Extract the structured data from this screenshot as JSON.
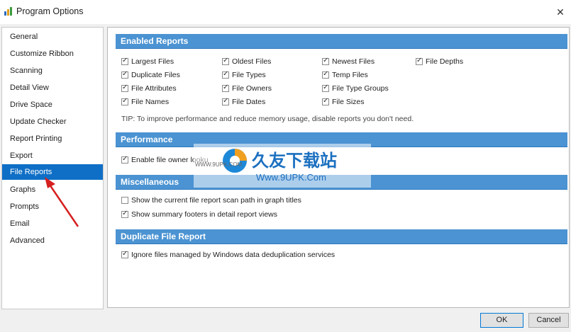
{
  "window": {
    "title": "Program Options",
    "close_glyph": "✕"
  },
  "sidebar": {
    "items": [
      {
        "label": "General"
      },
      {
        "label": "Customize Ribbon"
      },
      {
        "label": "Scanning"
      },
      {
        "label": "Detail View"
      },
      {
        "label": "Drive Space"
      },
      {
        "label": "Update Checker"
      },
      {
        "label": "Report Printing"
      },
      {
        "label": "Export"
      },
      {
        "label": "File Reports",
        "selected": true
      },
      {
        "label": "Graphs"
      },
      {
        "label": "Prompts"
      },
      {
        "label": "Email"
      },
      {
        "label": "Advanced"
      }
    ]
  },
  "sections": {
    "enabled_reports": {
      "title": "Enabled Reports",
      "options": [
        {
          "label": "Largest Files",
          "checked": true
        },
        {
          "label": "Oldest Files",
          "checked": true
        },
        {
          "label": "Newest Files",
          "checked": true
        },
        {
          "label": "File Depths",
          "checked": true
        },
        {
          "label": "Duplicate Files",
          "checked": true
        },
        {
          "label": "File Types",
          "checked": true
        },
        {
          "label": "Temp Files",
          "checked": true
        },
        {
          "label": "File Attributes",
          "checked": true
        },
        {
          "label": "File Owners",
          "checked": true
        },
        {
          "label": "File Type Groups",
          "checked": true
        },
        {
          "label": "File Names",
          "checked": true
        },
        {
          "label": "File Dates",
          "checked": true
        },
        {
          "label": "File Sizes",
          "checked": true
        }
      ],
      "tip": "TIP: To improve performance and reduce memory usage, disable reports you don't need."
    },
    "performance": {
      "title": "Performance",
      "options": [
        {
          "label": "Enable file owner looku",
          "checked": true
        }
      ]
    },
    "miscellaneous": {
      "title": "Miscellaneous",
      "options": [
        {
          "label": "Show the current file report scan path in graph titles",
          "checked": false
        },
        {
          "label": "Show summary footers in detail report views",
          "checked": true
        }
      ]
    },
    "duplicate_file_report": {
      "title": "Duplicate File Report",
      "options": [
        {
          "label": "Ignore files managed by Windows data deduplication services",
          "checked": true
        }
      ]
    }
  },
  "buttons": {
    "ok": "OK",
    "cancel": "Cancel"
  },
  "watermark": {
    "text": "久友下载站",
    "url": "Www.9UPK.Com",
    "small": "WWW.9UPK.COM"
  },
  "colors": {
    "accent": "#0f6fc6",
    "section_header": "#4b93d2",
    "arrow": "#d62020"
  }
}
